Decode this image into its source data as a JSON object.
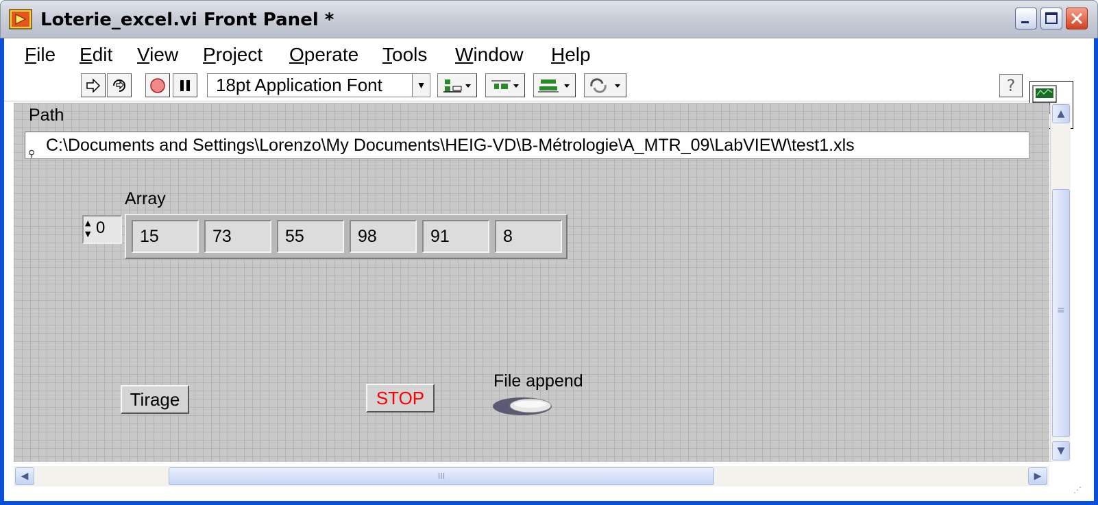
{
  "window": {
    "title": "Loterie_excel.vi Front Panel *"
  },
  "menubar": {
    "items": [
      {
        "label": "File",
        "mnemonic": "F"
      },
      {
        "label": "Edit",
        "mnemonic": "E"
      },
      {
        "label": "View",
        "mnemonic": "V"
      },
      {
        "label": "Project",
        "mnemonic": "P"
      },
      {
        "label": "Operate",
        "mnemonic": "O"
      },
      {
        "label": "Tools",
        "mnemonic": "T"
      },
      {
        "label": "Window",
        "mnemonic": "W"
      },
      {
        "label": "Help",
        "mnemonic": "H"
      }
    ]
  },
  "toolbar": {
    "font_select": "18pt Application Font",
    "icons": [
      "run-arrow-icon",
      "run-continuously-icon",
      "abort-icon",
      "pause-icon",
      "align-objects-icon",
      "distribute-objects-icon",
      "resize-objects-icon",
      "reorder-icon",
      "context-help-icon"
    ],
    "connector_pane_number": "3"
  },
  "panel": {
    "path_label": "Path",
    "path_value": "C:\\Documents and Settings\\Lorenzo\\My Documents\\HEIG-VD\\B-Métrologie\\A_MTR_09\\LabVIEW\\test1.xls",
    "array_label": "Array",
    "array_index": "0",
    "array_values": [
      "15",
      "73",
      "55",
      "98",
      "91",
      "8"
    ],
    "tirage_label": "Tirage",
    "stop_label": "STOP",
    "file_append_label": "File append",
    "file_append_state": "off",
    "stop_color": "#ff0000"
  },
  "scrollbar": {
    "h_thumb_grip": "III",
    "v_thumb_grip": "≡"
  }
}
